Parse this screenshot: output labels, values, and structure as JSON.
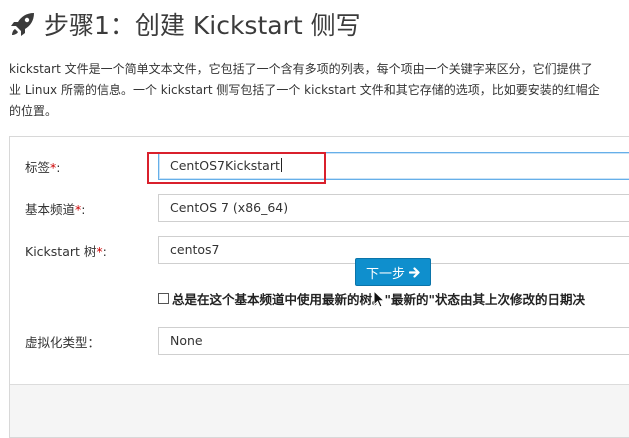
{
  "header": {
    "icon": "rocket-icon",
    "title": "步骤1：创建 Kickstart 侧写"
  },
  "intro": {
    "line1": "kickstart 文件是一个简单文本文件，它包括了一个含有多项的列表，每个项由一个关键字来区分，它们提供了",
    "line2": "业 Linux 所需的信息。一个 kickstart 侧写包括了一个 kickstart 文件和其它存储的选项，比如要安装的红帽企",
    "line3": "的位置。"
  },
  "form": {
    "required_marker": "*",
    "label": {
      "text": "标签",
      "suffix": ":",
      "value": "CentOS7Kickstart"
    },
    "base_channel": {
      "text": "基本频道",
      "suffix": ":",
      "value": "CentOS 7 (x86_64)"
    },
    "tree": {
      "text": "Kickstart 树",
      "suffix": ":",
      "value": "centos7"
    },
    "always_latest": {
      "text": "总是在这个基本频道中使用最新的树。\"最新的\"状态由其上次修改的日期决",
      "checked": false
    },
    "virt_type": {
      "text": "虚拟化类型：",
      "value": "None"
    }
  },
  "actions": {
    "next_label": "下一步",
    "next_icon": "arrow-right-icon"
  },
  "colors": {
    "required": "#cc0000",
    "highlight": "#d9202c",
    "primary_button": "#0f8fcd"
  }
}
